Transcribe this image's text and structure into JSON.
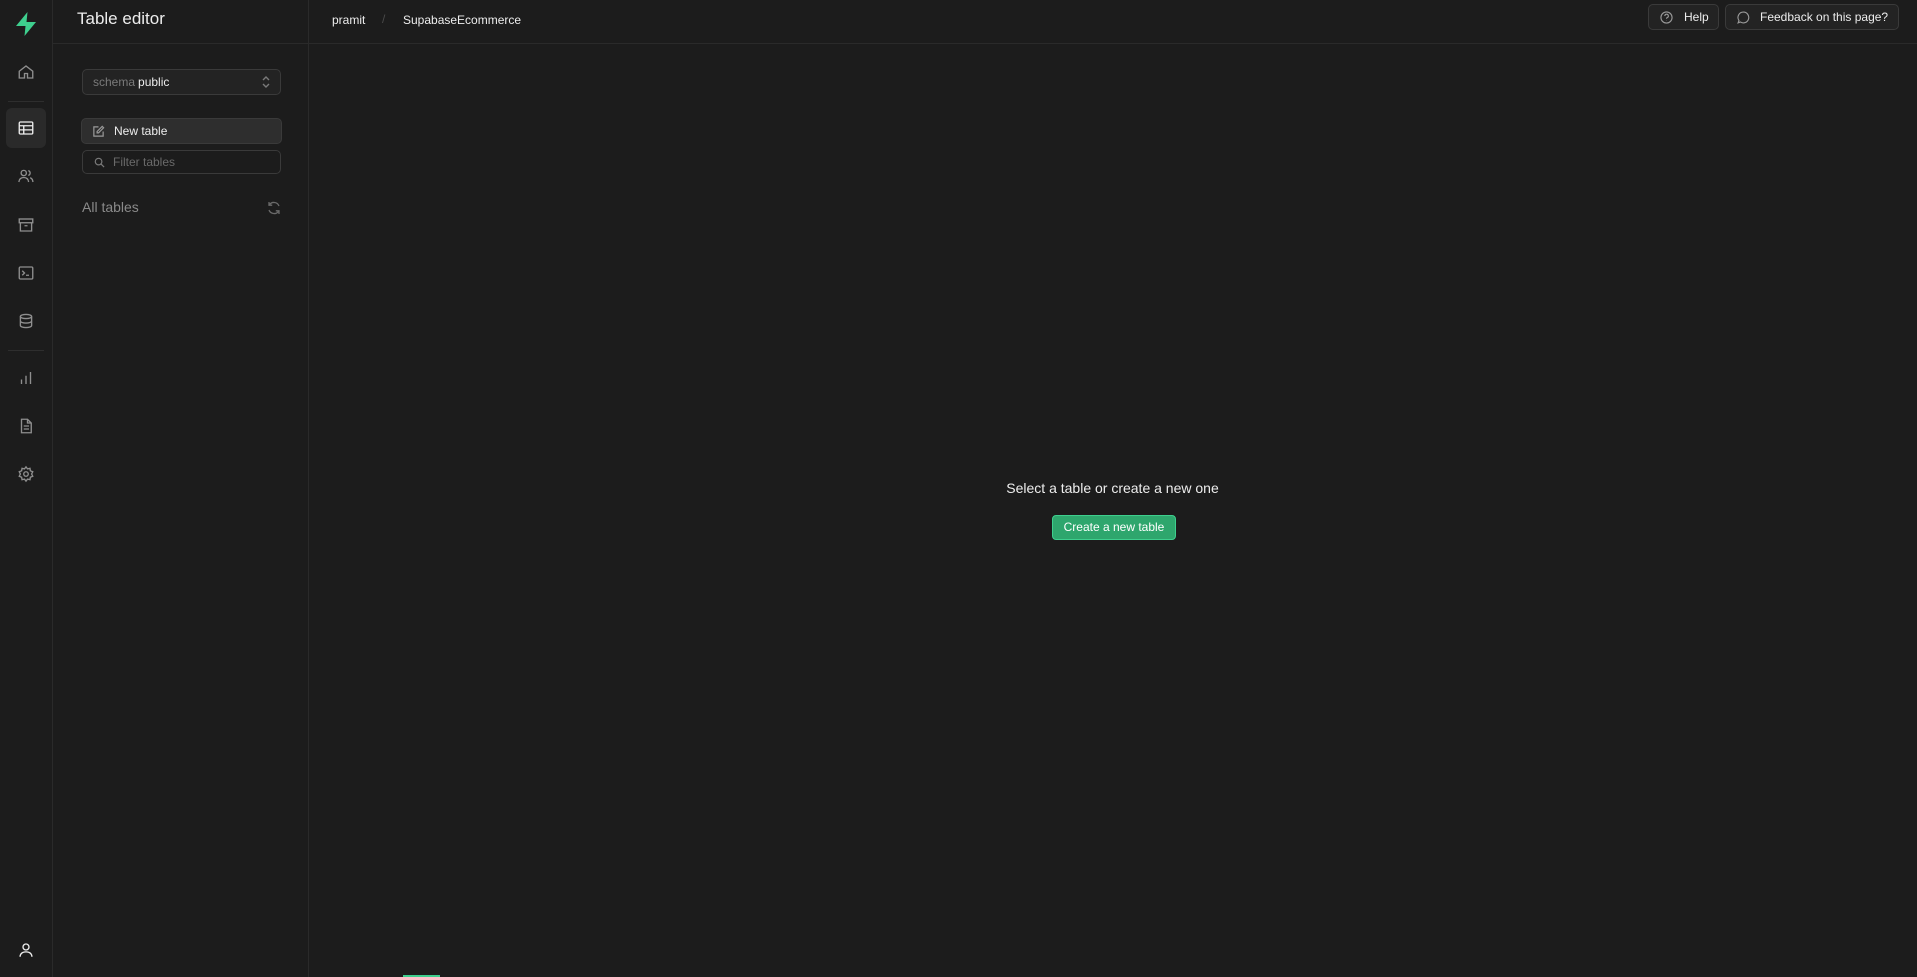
{
  "sidebar": {
    "title": "Table editor",
    "schema": {
      "label": "schema",
      "value": "public"
    },
    "new_table_label": "New table",
    "filter_placeholder": "Filter tables",
    "all_tables_label": "All tables"
  },
  "breadcrumb": {
    "org": "pramit",
    "separator": "/",
    "project": "SupabaseEcommerce"
  },
  "header": {
    "help_label": "Help",
    "feedback_label": "Feedback on this page?"
  },
  "main": {
    "empty_title": "Select a table or create a new one",
    "create_label": "Create a new table"
  },
  "rail": {
    "items": [
      "home-icon",
      "table-editor-icon",
      "users-icon",
      "storage-icon",
      "sql-editor-icon",
      "database-icon",
      "reports-icon",
      "docs-icon",
      "settings-icon",
      "account-icon"
    ],
    "active": "table-editor-icon"
  },
  "colors": {
    "background": "#1c1c1c",
    "brand": "#3ecf8e",
    "button_primary": "#2ea66d"
  }
}
